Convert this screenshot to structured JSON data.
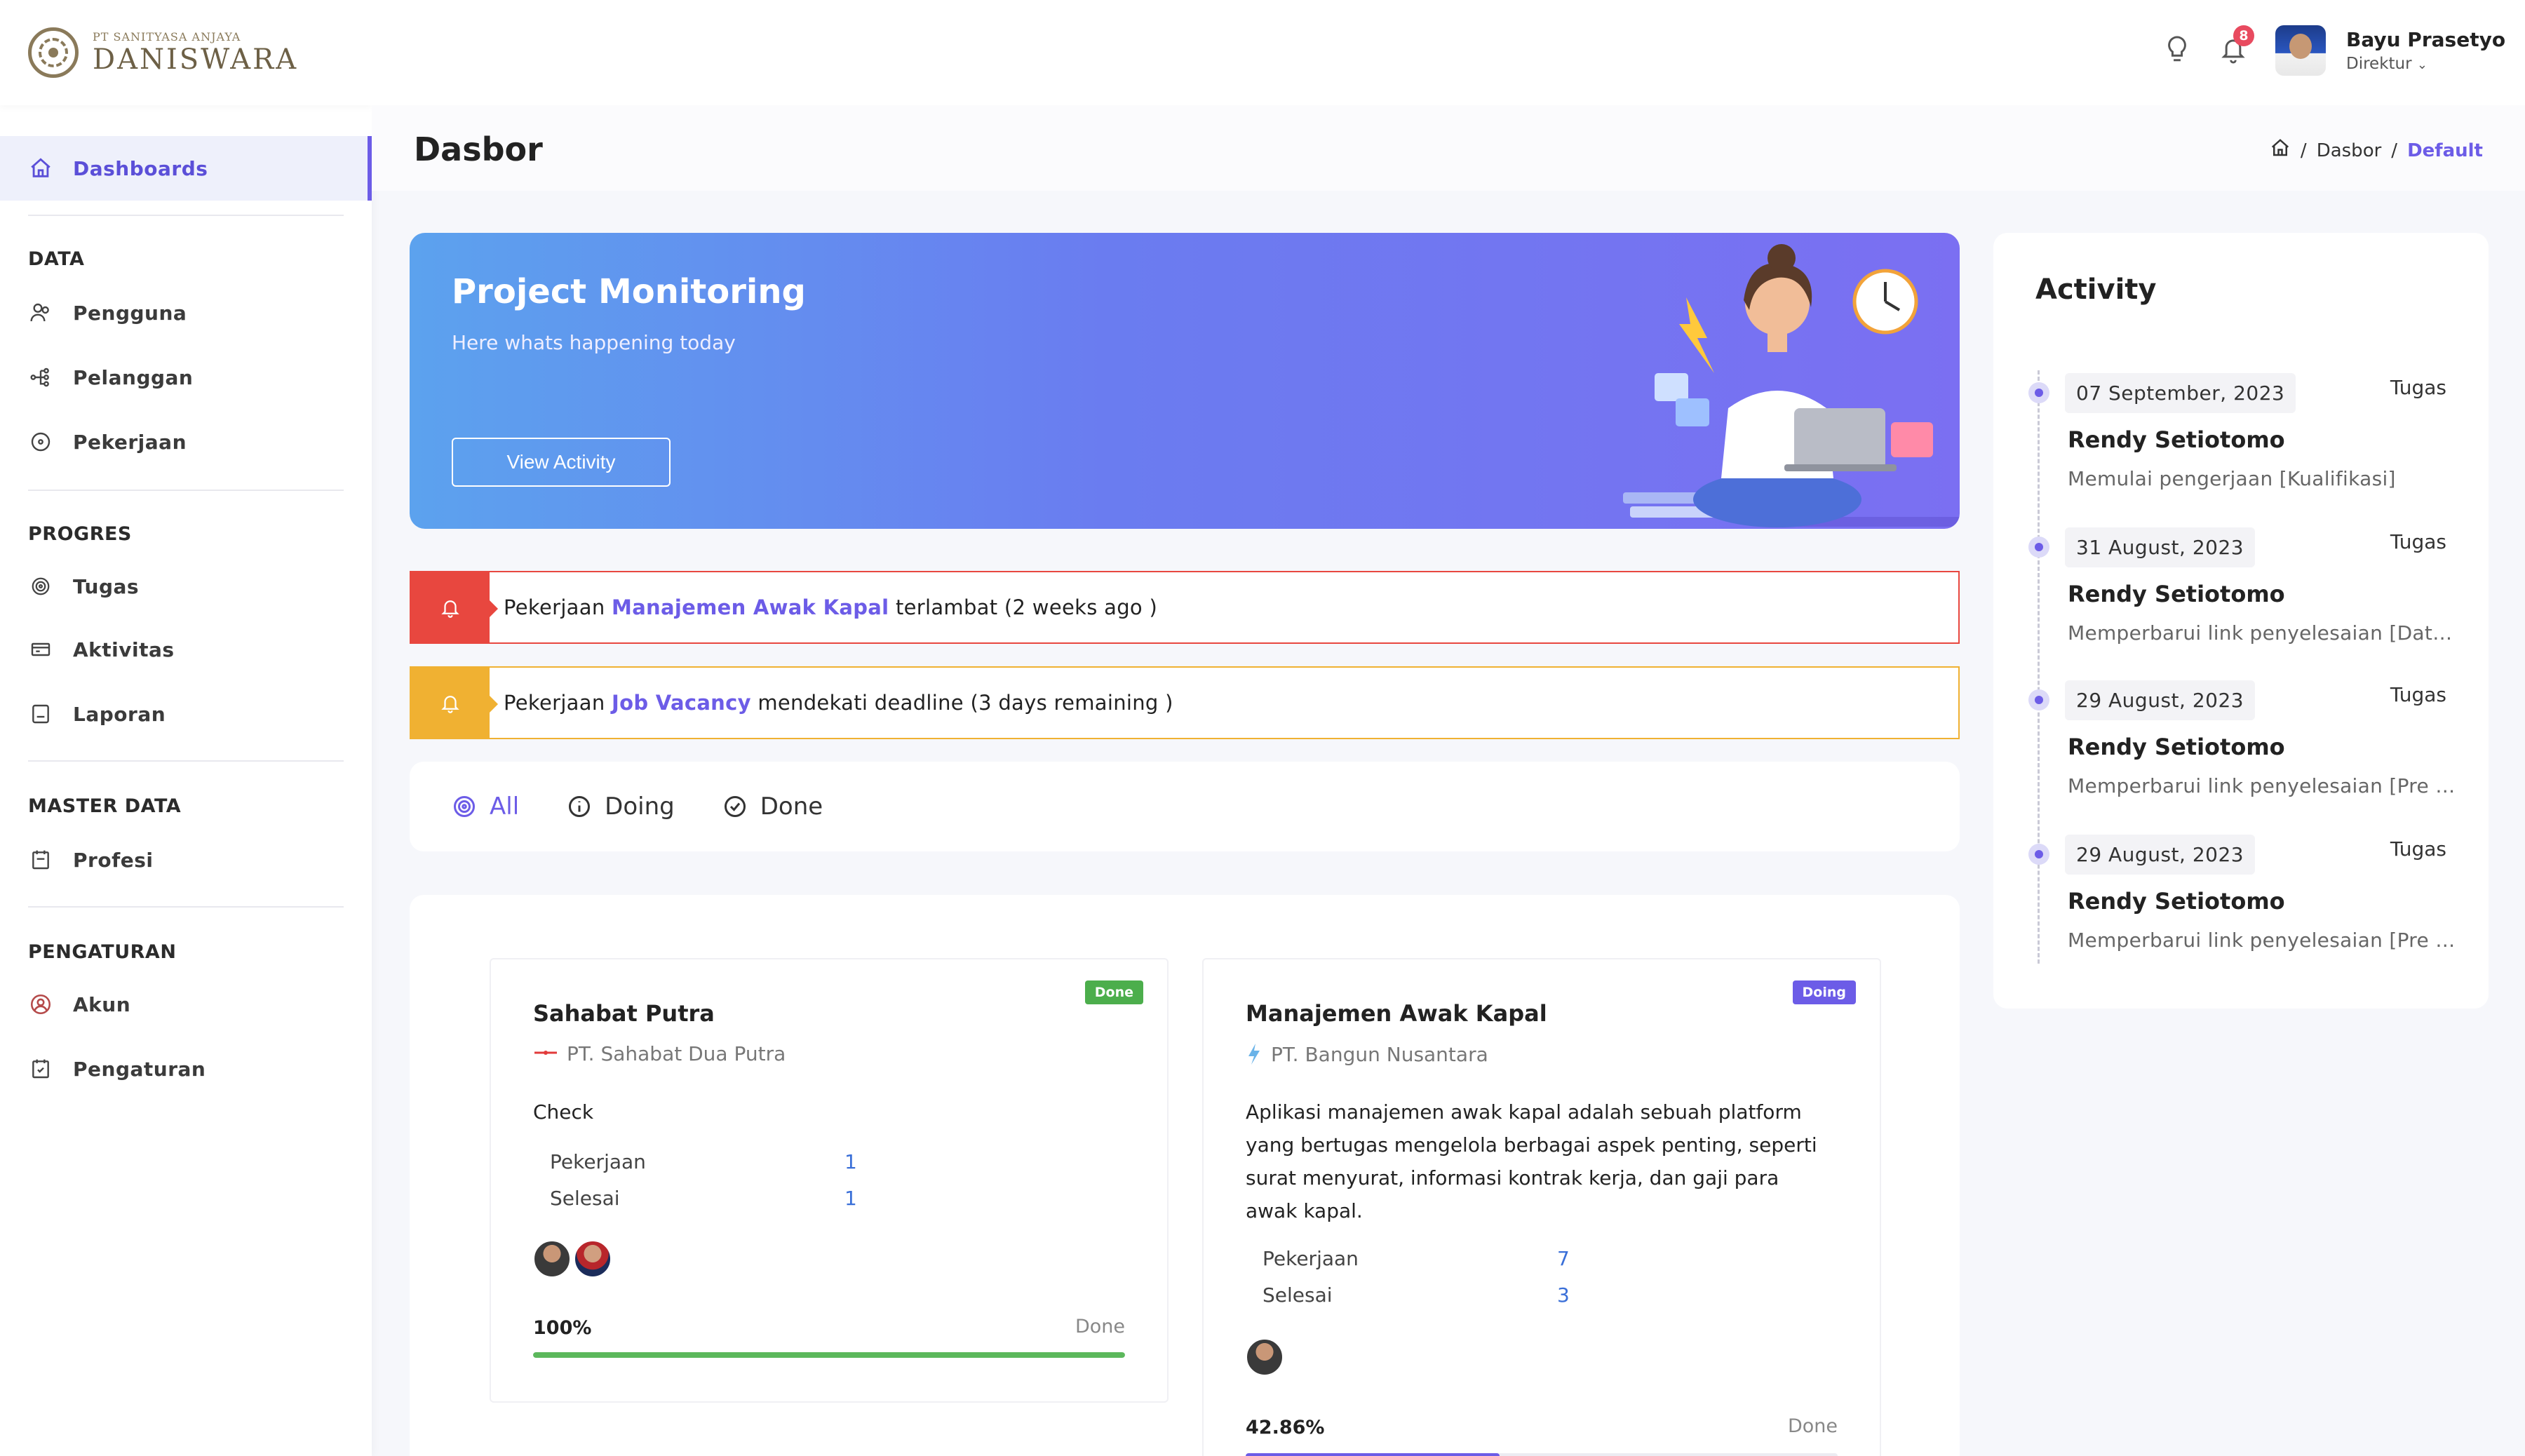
{
  "brand": {
    "small": "PT SANITYASA ANJAYA",
    "name": "DANISWARA"
  },
  "sidebar": {
    "active_item": "Dashboards",
    "sections": [
      {
        "title": "DATA",
        "items": [
          "Pengguna",
          "Pelanggan",
          "Pekerjaan"
        ]
      },
      {
        "title": "PROGRES",
        "items": [
          "Tugas",
          "Aktivitas",
          "Laporan"
        ]
      },
      {
        "title": "MASTER DATA",
        "items": [
          "Profesi"
        ]
      },
      {
        "title": "PENGATURAN",
        "items": [
          "Akun",
          "Pengaturan"
        ]
      }
    ]
  },
  "topbar": {
    "notification_count": "8",
    "user_name": "Bayu Prasetyo",
    "user_role": "Direktur"
  },
  "page": {
    "title": "Dasbor",
    "breadcrumb": [
      "Dasbor",
      "Default"
    ]
  },
  "hero": {
    "title": "Project Monitoring",
    "subtitle": "Here whats happening today",
    "button": "View Activity"
  },
  "alerts": [
    {
      "prefix": "Pekerjaan ",
      "project": "Manajemen Awak Kapal",
      "suffix": " terlambat (2 weeks ago )",
      "color": "#e8473f"
    },
    {
      "prefix": "Pekerjaan ",
      "project": "Job Vacancy",
      "suffix": " mendekati deadline (3 days remaining )",
      "color": "#f0b132"
    }
  ],
  "filters": [
    "All",
    "Doing",
    "Done"
  ],
  "projects": [
    {
      "title": "Sahabat Putra",
      "company": "PT. Sahabat Dua Putra",
      "status": "Done",
      "description": "Check",
      "stats": [
        {
          "label": "Pekerjaan",
          "value": "1"
        },
        {
          "label": "Selesai",
          "value": "1"
        }
      ],
      "progress_label": "100%",
      "progress": 1.0,
      "progress_status": "Done",
      "bar_color": "#5cb85c"
    },
    {
      "title": "Manajemen Awak Kapal",
      "company": "PT. Bangun Nusantara",
      "status": "Doing",
      "description": "Aplikasi manajemen awak kapal adalah sebuah platform yang bertugas mengelola berbagai aspek penting, seperti surat menyurat, informasi kontrak kerja, dan gaji para awak kapal.",
      "stats": [
        {
          "label": "Pekerjaan",
          "value": "7"
        },
        {
          "label": "Selesai",
          "value": "3"
        }
      ],
      "progress_label": "42.86%",
      "progress": 0.4286,
      "progress_status": "Done",
      "bar_color": "#6c5ce7"
    }
  ],
  "activity": {
    "title": "Activity",
    "items": [
      {
        "date": "07 September, 2023",
        "tag": "Tugas",
        "name": "Rendy Setiotomo",
        "desc": "Memulai pengerjaan [Kualifikasi]"
      },
      {
        "date": "31 August, 2023",
        "tag": "Tugas",
        "name": "Rendy Setiotomo",
        "desc": "Memperbarui link penyelesaian [Data Diri]"
      },
      {
        "date": "29 August, 2023",
        "tag": "Tugas",
        "name": "Rendy Setiotomo",
        "desc": "Memperbarui link penyelesaian [Pre Screening]"
      },
      {
        "date": "29 August, 2023",
        "tag": "Tugas",
        "name": "Rendy Setiotomo",
        "desc": "Memperbarui link penyelesaian [Pre Screening]"
      }
    ]
  },
  "colors": {
    "accent": "#6c5ce7",
    "danger": "#e8473f",
    "warning": "#f0b132",
    "success": "#5cb85c"
  }
}
